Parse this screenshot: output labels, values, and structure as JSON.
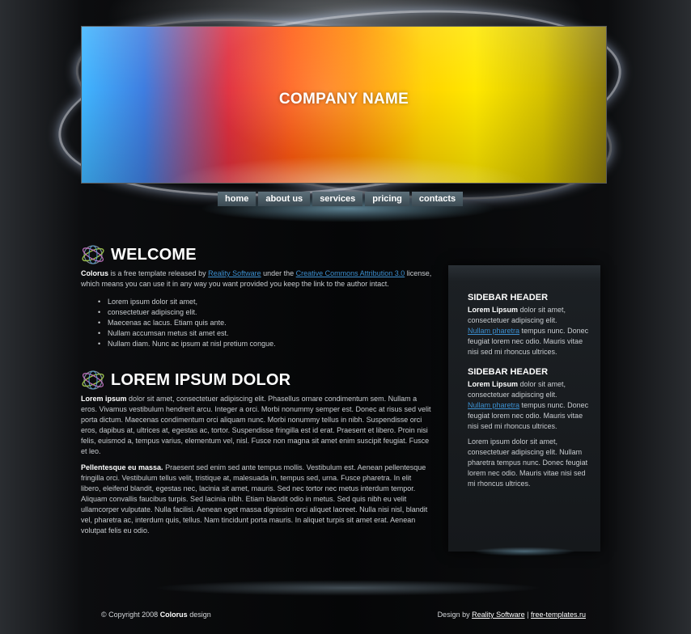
{
  "header": {
    "company_name": "COMPANY NAME"
  },
  "nav": {
    "items": [
      {
        "label": "home"
      },
      {
        "label": "about us"
      },
      {
        "label": "services"
      },
      {
        "label": "pricing"
      },
      {
        "label": "contacts"
      }
    ]
  },
  "welcome": {
    "title": "WELCOME",
    "intro_bold": "Colorus",
    "intro_1": " is a free template released by ",
    "link_1": "Reality Software",
    "intro_2": " under the ",
    "link_2": "Creative Commons Attribution 3.0",
    "intro_3": " license, which means you can use it in any way you want provided you keep the link to the author intact.",
    "list": [
      "Lorem ipsum dolor sit amet,",
      "consectetuer adipiscing elit.",
      "Maecenas ac lacus. Etiam quis ante.",
      "Nullam accumsan metus sit amet est.",
      "Nullam diam. Nunc ac ipsum at nisl pretium congue."
    ]
  },
  "lorem": {
    "title": "LOREM IPSUM DOLOR",
    "p1_bold": "Lorem ipsum",
    "p1_text": " dolor sit amet, consectetuer adipiscing elit. Phasellus ornare condimentum sem. Nullam a eros. Vivamus vestibulum hendrerit arcu. Integer a orci. Morbi nonummy semper est. Donec at risus sed velit porta dictum. Maecenas condimentum orci aliquam nunc. Morbi nonummy tellus in nibh. Suspendisse orci eros, dapibus at, ultrices at, egestas ac, tortor. Suspendisse fringilla est id erat. Praesent et libero. Proin nisi felis, euismod a, tempus varius, elementum vel, nisl. Fusce non magna sit amet enim suscipit feugiat. Fusce et leo.",
    "p2_bold": "Pellentesque eu massa.",
    "p2_text": " Praesent sed enim sed ante tempus mollis. Vestibulum est. Aenean pellentesque fringilla orci. Vestibulum tellus velit, tristique at, malesuada in, tempus sed, urna. Fusce pharetra. In elit libero, eleifend blandit, egestas nec, lacinia sit amet, mauris. Sed nec tortor nec metus interdum tempor. Aliquam convallis faucibus turpis. Sed lacinia nibh. Etiam blandit odio in metus. Sed quis nibh eu velit ullamcorper vulputate. Nulla facilisi. Aenean eget massa dignissim orci aliquet laoreet. Nulla nisi nisl, blandit vel, pharetra ac, interdum quis, tellus. Nam tincidunt porta mauris. In aliquet turpis sit amet erat. Aenean volutpat felis eu odio."
  },
  "sidebar": {
    "block1": {
      "header": "SIDEBAR HEADER",
      "bold": "Lorem Lipsum",
      "text1": " dolor sit amet, consectetuer adipiscing elit.",
      "link": "Nullam pharetra",
      "text2": " tempus nunc. Donec feugiat lorem nec odio. Mauris vitae nisi sed mi rhoncus ultrices."
    },
    "block2": {
      "header": "SIDEBAR HEADER",
      "bold": "Lorem Lipsum",
      "text1": " dolor sit amet, consectetuer adipiscing elit.",
      "link": "Nullam pharetra",
      "text2": " tempus nunc. Donec feugiat lorem nec odio. Mauris vitae nisi sed mi rhoncus ultrices.",
      "extra": "Lorem ipsum dolor sit amet, consectetuer adipiscing elit. Nullam pharetra tempus nunc. Donec feugiat lorem nec odio. Mauris vitae nisi sed mi rhoncus ultrices."
    }
  },
  "footer": {
    "copyright_1": "© Copyright 2008 ",
    "copyright_bold": "Colorus",
    "copyright_2": " design",
    "design_by": "Design by ",
    "link_1": "Reality Software",
    "separator": " | ",
    "link_2": "free-templates.ru"
  }
}
